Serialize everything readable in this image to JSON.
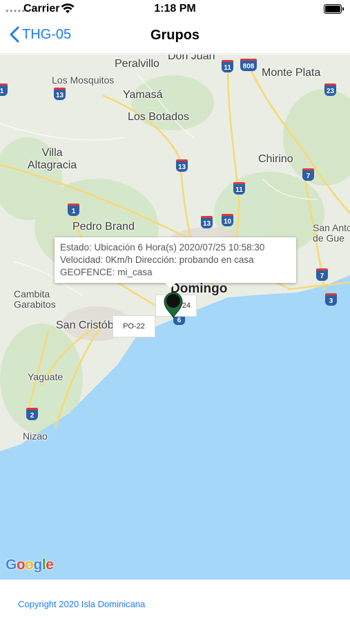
{
  "status_bar": {
    "carrier": "Carrier",
    "time": "1:18 PM"
  },
  "nav": {
    "back_label": "THG-05",
    "title": "Grupos"
  },
  "map": {
    "places": {
      "peralvillo": "Peralvillo",
      "don_juan": "Don Juan",
      "monte_plata": "Monte Plata",
      "los_mosquitos": "Los Mosquitos",
      "yamasa": "Yamasá",
      "los_botados": "Los Botados",
      "villa_altagracia": "Villa\nAltagracia",
      "chirino": "Chirino",
      "pedro_brand": "Pedro Brand",
      "san_antonio": "San Anto\nde Gue",
      "cambita": "Cambita\nGarabitos",
      "santo_domingo": "Domingo",
      "san_cristobal": "San Cristób",
      "yaguate": "Yaguate",
      "nizao": "Nizao"
    },
    "shields": {
      "s11a": "11",
      "s808": "808",
      "s1a": "1",
      "s13a": "13",
      "s23": "23",
      "s13b": "13",
      "s7a": "7",
      "s11b": "11",
      "s1b": "1",
      "s13c": "13",
      "s10": "10",
      "s7b": "7",
      "s3": "3",
      "s2": "2",
      "s6": "6"
    },
    "info_window": {
      "line1": "Estado: Ubicación 6 Hora(s)  2020/07/25 10:58:30",
      "line2": "Velocidad: 0Km/h  Dirección: probando en casa",
      "line3": "GEOFENCE: mi_casa"
    },
    "plates": {
      "plate1": "PO-22",
      "plate2": "24"
    },
    "marker_color": "#1e6b3a",
    "water_color": "#a5d7f8",
    "land_color": "#e9ede3",
    "attribution": "Google"
  },
  "footer": {
    "copyright": "Copyright 2020 Isla Dominicana"
  }
}
